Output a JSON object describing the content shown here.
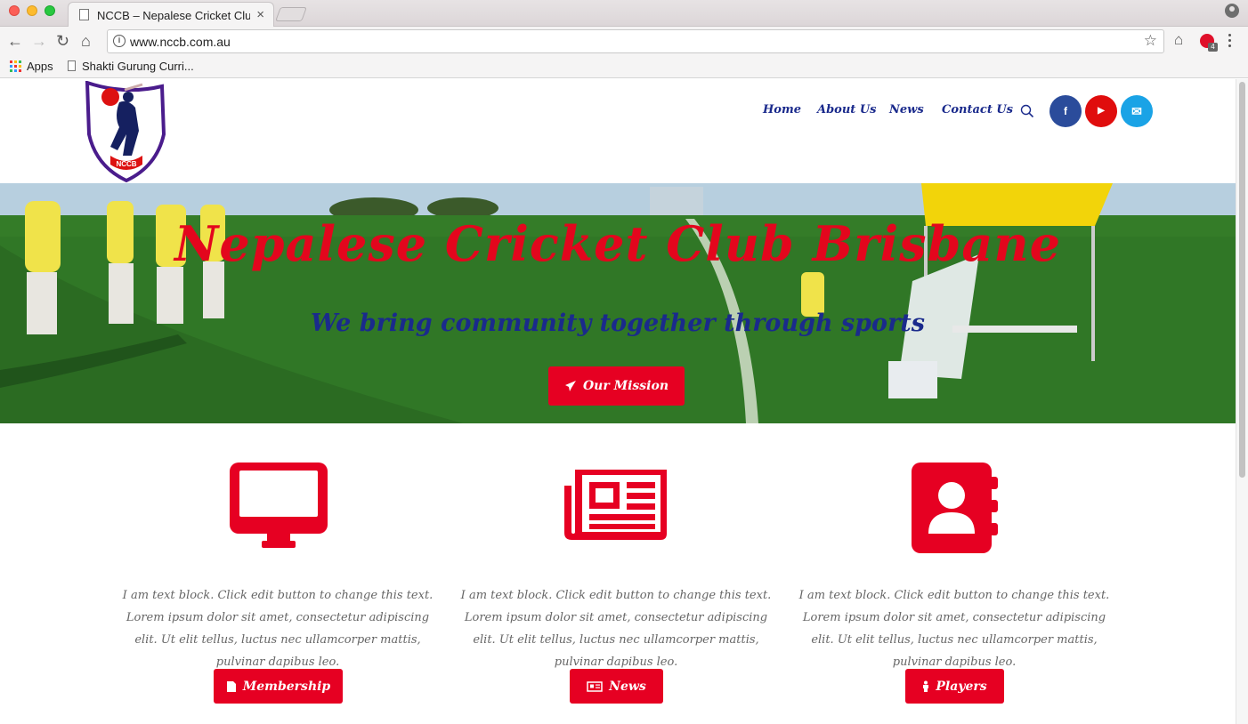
{
  "browser": {
    "tab_title": "NCCB – Nepalese Cricket Club",
    "url": "www.nccb.com.au",
    "extension_badge": "4",
    "bookmarks": [
      {
        "label": "Apps"
      },
      {
        "label": "Shakti Gurung Curri..."
      }
    ]
  },
  "site": {
    "logo": {
      "text": "NCCB",
      "alt": "Nepalese Cricket Club Brisbane"
    },
    "nav": [
      {
        "label": "Home"
      },
      {
        "label": "About Us"
      },
      {
        "label": "News"
      },
      {
        "label": "Contact Us"
      }
    ],
    "social": [
      {
        "icon": "facebook-icon",
        "glyph": "f",
        "color": "#2b4c9b"
      },
      {
        "icon": "youtube-icon",
        "glyph": "▶",
        "color": "#e00d0d"
      },
      {
        "icon": "email-icon",
        "glyph": "✉",
        "color": "#1aa3e6"
      }
    ],
    "hero": {
      "title": "Nepalese Cricket Club Brisbane",
      "subtitle": "We bring community together through sports",
      "button_label": "Our Mission"
    },
    "features": [
      {
        "icon": "desktop-icon",
        "text": "I am text block. Click edit button to change this text. Lorem ipsum dolor sit amet, consectetur adipiscing elit. Ut elit tellus, luctus nec ullamcorper mattis, pulvinar dapibus leo.",
        "button_label": "Membership",
        "button_icon": "document-icon"
      },
      {
        "icon": "newspaper-icon",
        "text": "I am text block. Click edit button to change this text. Lorem ipsum dolor sit amet, consectetur adipiscing elit. Ut elit tellus, luctus nec ullamcorper mattis, pulvinar dapibus leo.",
        "button_label": "News",
        "button_icon": "newspaper-small-icon"
      },
      {
        "icon": "address-book-icon",
        "text": "I am text block. Click edit button to change this text. Lorem ipsum dolor sit amet, consectetur adipiscing elit. Ut elit tellus, luctus nec ullamcorper mattis, pulvinar dapibus leo.",
        "button_label": "Players",
        "button_icon": "person-icon"
      }
    ]
  },
  "colors": {
    "accent_red": "#e60022",
    "nav_blue": "#1a2a8c",
    "body_text": "#666666"
  }
}
